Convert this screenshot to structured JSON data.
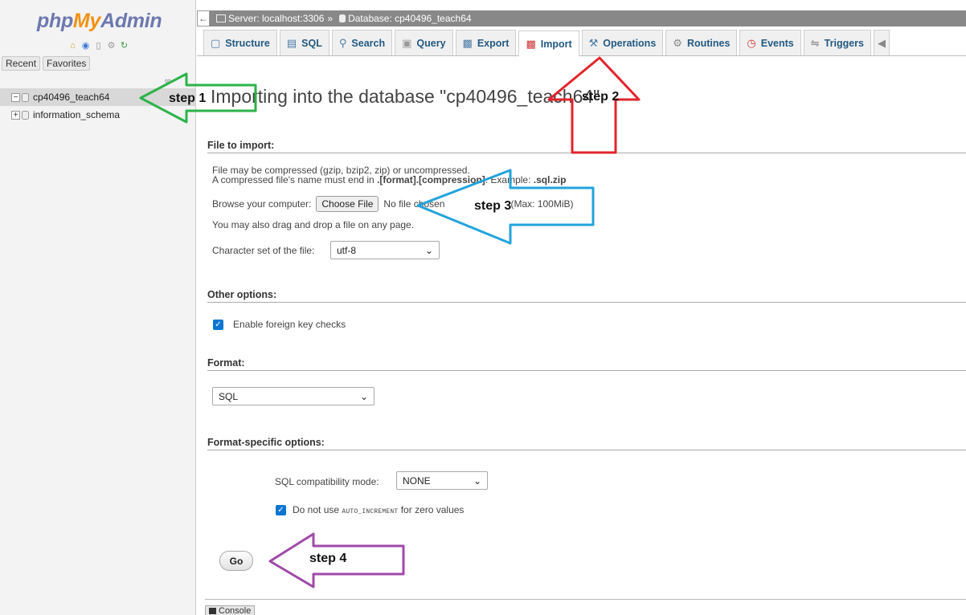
{
  "logo": {
    "part1": "php",
    "part2": "My",
    "part3": "Admin"
  },
  "sidebar": {
    "recent_label": "Recent",
    "favorites_label": "Favorites",
    "databases": [
      {
        "name": "cp40496_teach64",
        "expander": "−",
        "selected": true
      },
      {
        "name": "information_schema",
        "expander": "+",
        "selected": false
      }
    ]
  },
  "breadcrumb": {
    "server": "Server: localhost:3306",
    "separator": "»",
    "database": "Database: cp40496_teach64"
  },
  "tabs": [
    {
      "label": "Structure",
      "icon": "structure-icon"
    },
    {
      "label": "SQL",
      "icon": "sql-icon"
    },
    {
      "label": "Search",
      "icon": "search-icon"
    },
    {
      "label": "Query",
      "icon": "query-icon"
    },
    {
      "label": "Export",
      "icon": "export-icon"
    },
    {
      "label": "Import",
      "icon": "import-icon",
      "active": true
    },
    {
      "label": "Operations",
      "icon": "wrench-icon"
    },
    {
      "label": "Routines",
      "icon": "routines-icon"
    },
    {
      "label": "Events",
      "icon": "clock-icon"
    },
    {
      "label": "Triggers",
      "icon": "triggers-icon"
    }
  ],
  "main": {
    "title": "Importing into the database \"cp40496_teach64\"",
    "file_section": {
      "heading": "File to import:",
      "line1": "File may be compressed (gzip, bzip2, zip) or uncompressed.",
      "line2_prefix": "A compressed file's name must end in ",
      "line2_bold": ".[format].[compression]",
      "line2_mid": ". Example: ",
      "line2_example": ".sql.zip",
      "browse_label": "Browse your computer:",
      "choose_file_button": "Choose File",
      "no_file_text": "No file chosen",
      "max_size": "(Max: 100MiB)",
      "drag_drop_text": "You may also drag and drop a file on any page.",
      "charset_label": "Character set of the file:",
      "charset_value": "utf-8"
    },
    "other_section": {
      "heading": "Other options:",
      "foreign_key_label": "Enable foreign key checks",
      "foreign_key_checked": true
    },
    "format_section": {
      "heading": "Format:",
      "format_value": "SQL"
    },
    "format_specific_section": {
      "heading": "Format-specific options:",
      "compat_label": "SQL compatibility mode:",
      "compat_value": "NONE",
      "auto_inc_prefix": "Do not use ",
      "auto_inc_code": "AUTO_INCREMENT",
      "auto_inc_suffix": " for zero values",
      "auto_inc_checked": true
    },
    "go_button": "Go",
    "console_label": "Console"
  },
  "annotations": {
    "step1": "step 1",
    "step2": "step 2",
    "step3": "step 3",
    "step4": "step 4",
    "colors": {
      "step1": "#2db34a",
      "step2": "#e2242b",
      "step3": "#22a3dc",
      "step4": "#a04aa8"
    }
  }
}
